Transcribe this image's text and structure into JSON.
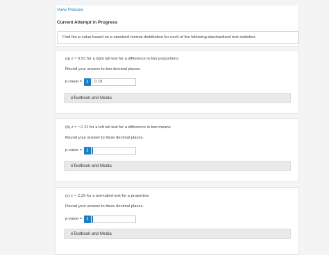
{
  "header": {
    "view_policies": "View Policies",
    "attempt_title": "Current Attempt in Progress"
  },
  "instruction": "Find the p-value based on a standard normal distribution for each of the following standardized test statistics.",
  "questions": [
    {
      "prefix": "(a) ",
      "var": "z",
      "eq": " = ",
      "value": "0.93",
      "desc": " for a right tail test for a difference in two proportions",
      "round_text": "Round your answer to two decimal places.",
      "pvalue_label": "p-value =",
      "info_icon": "i",
      "answer": "0.18",
      "etext": "eTextbook and Media"
    },
    {
      "prefix": "(b) ",
      "var": "z",
      "eq": " = ",
      "value": "−2.33",
      "desc": " for a left tail test for a difference in two means",
      "round_text": "Round your answer to three decimal places.",
      "pvalue_label": "p-value =",
      "info_icon": "i",
      "answer": "",
      "etext": "eTextbook and Media"
    },
    {
      "prefix": "(c) ",
      "var": "z",
      "eq": " = ",
      "value": "2.29",
      "desc": " for a two-tailed test for a proportion",
      "round_text": "Round your answer to three decimal places.",
      "pvalue_label": "p-value =",
      "info_icon": "i",
      "answer": "",
      "etext": "eTextbook and Media"
    }
  ]
}
